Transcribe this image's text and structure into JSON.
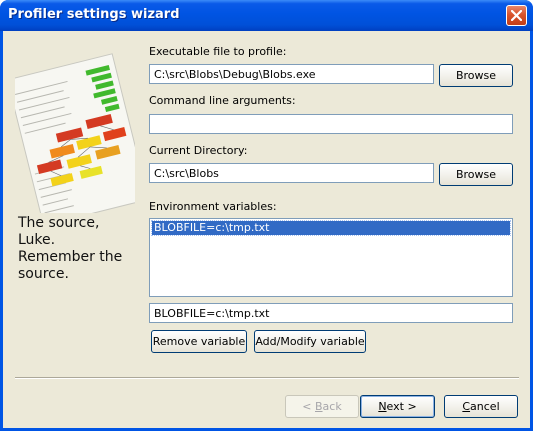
{
  "window": {
    "title": "Profiler settings wizard"
  },
  "sidebar": {
    "quote_lines": [
      "The source,",
      "Luke.",
      "Remember the",
      "source."
    ]
  },
  "form": {
    "executable_label": "Executable file to profile:",
    "executable_value": "C:\\src\\Blobs\\Debug\\Blobs.exe",
    "browse_label": "Browse",
    "args_label": "Command line arguments:",
    "args_value": "",
    "curdir_label": "Current Directory:",
    "curdir_value": "C:\\src\\Blobs",
    "env_label": "Environment variables:",
    "env_items": [
      "BLOBFILE=c:\\tmp.txt"
    ],
    "env_edit_value": "BLOBFILE=c:\\tmp.txt",
    "remove_label": "Remove variable",
    "addmodify_label": "Add/Modify variable"
  },
  "footer": {
    "back_prefix": "< ",
    "back_hotkey": "B",
    "back_rest": "ack",
    "next_hotkey": "N",
    "next_rest": "ext >",
    "cancel_hotkey": "C",
    "cancel_rest": "ancel"
  },
  "colors": {
    "titlebar": "#0054e3",
    "selection": "#316ac5",
    "face": "#ece9d8"
  }
}
